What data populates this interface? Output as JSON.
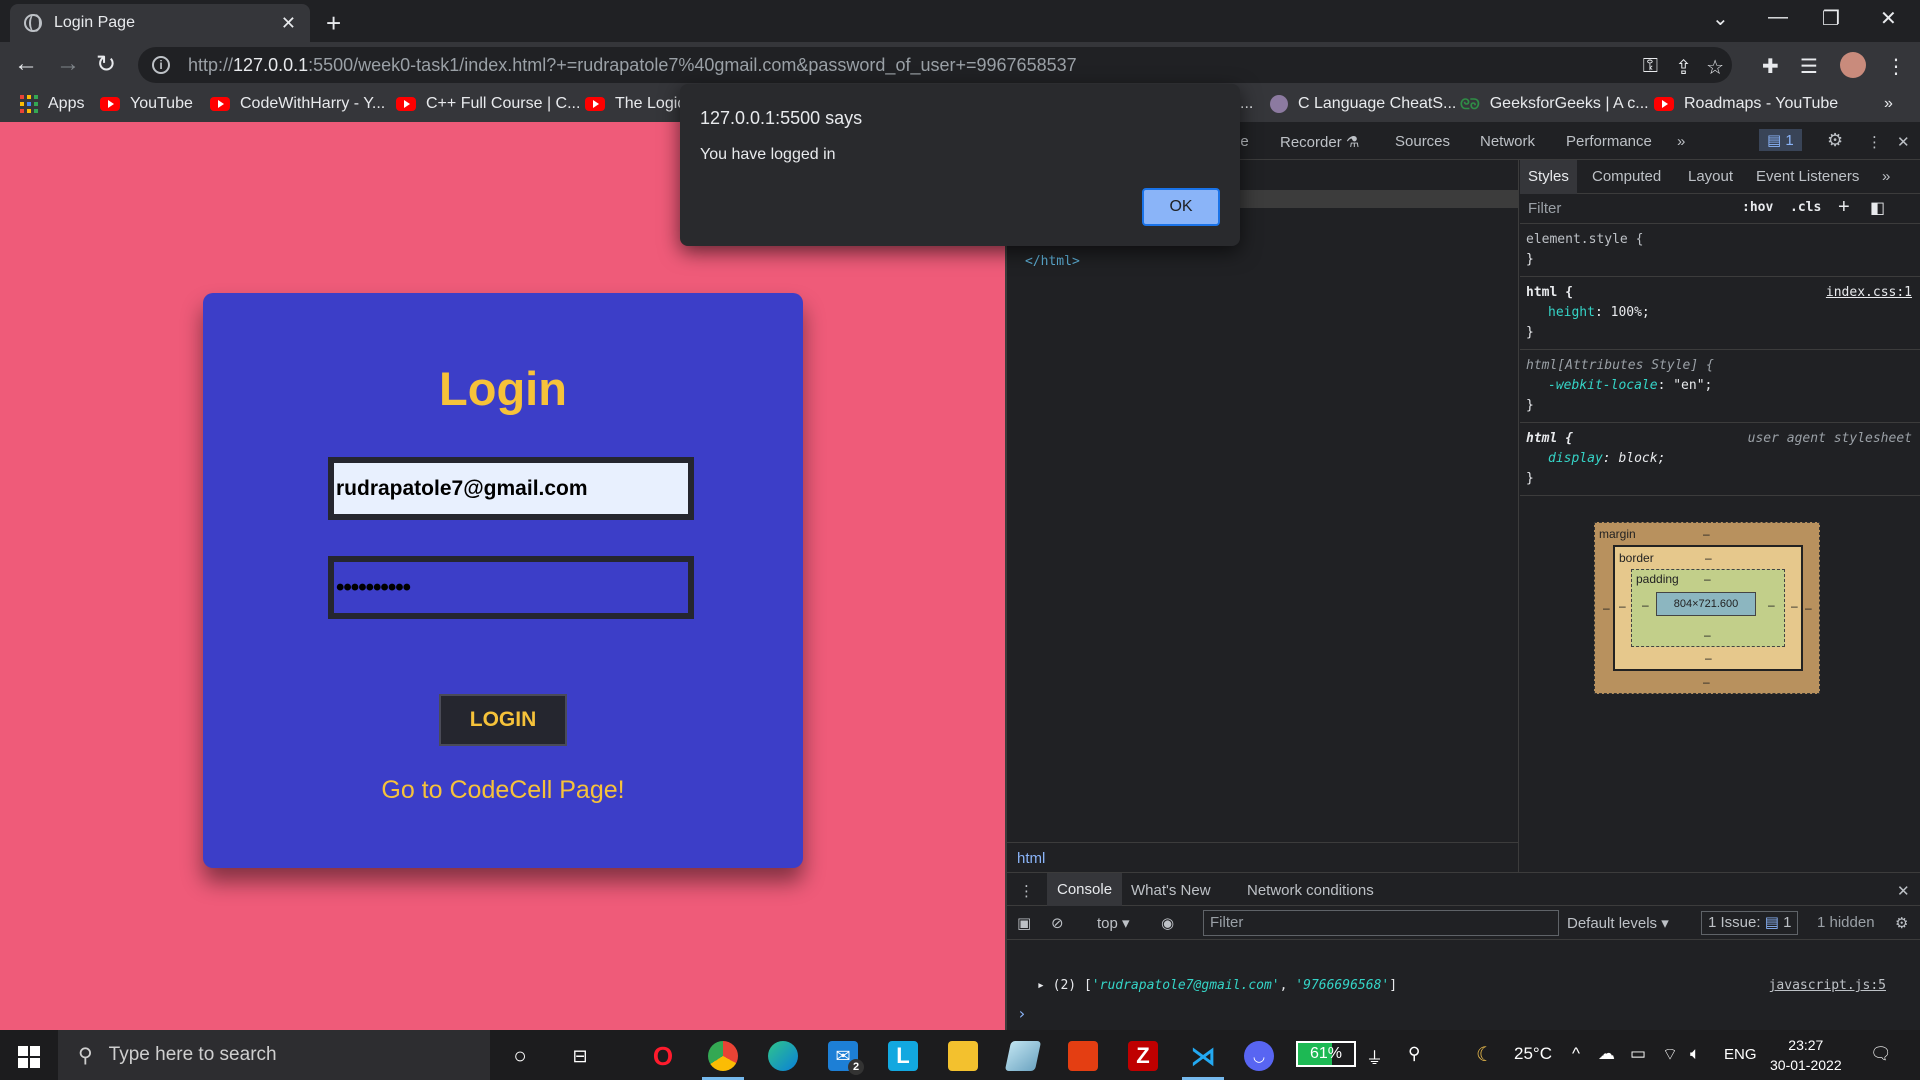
{
  "browser": {
    "tab_title": "Login Page",
    "url_host": "127.0.0.1",
    "url_rest": ":5500/week0-task1/index.html?+=rudrapatole7%40gmail.com&password_of_user+=9967658537",
    "url_prefix": "http://"
  },
  "bookmarks": [
    {
      "label": "Apps"
    },
    {
      "label": "YouTube"
    },
    {
      "label": "CodeWithHarry - Y..."
    },
    {
      "label": "C++ Full Course | C..."
    },
    {
      "label": "The Logic"
    },
    {
      "label": "C Language CheatS..."
    },
    {
      "label": "GeeksforGeeks | A c..."
    },
    {
      "label": "Roadmaps - YouTube"
    }
  ],
  "alert": {
    "origin": "127.0.0.1:5500 says",
    "message": "You have logged in",
    "ok_label": "OK"
  },
  "login_page": {
    "heading": "Login",
    "email_value": "rudrapatole7@gmail.com",
    "password_mask": "••••••••••",
    "button_label": "LOGIN",
    "link_text": "Go to CodeCell Page!"
  },
  "devtools": {
    "tabs": [
      "le",
      "Recorder",
      "Sources",
      "Network",
      "Performance",
      "»"
    ],
    "issues_badge": "1",
    "elements_code": "</html>",
    "breadcrumb": "html",
    "styles_tabs": [
      "Styles",
      "Computed",
      "Layout",
      "Event Listeners",
      "»"
    ],
    "filter_placeholder": "Filter",
    "hov": ":hov",
    "cls": ".cls",
    "rules": {
      "r1_selector": "element.style {",
      "r2_selector": "html {",
      "r2_source": "index.css:1",
      "r2_prop": "height",
      "r2_val": "100%;",
      "r3_selector": "html[Attributes Style] {",
      "r3_prop": "-webkit-locale",
      "r3_val": "\"en\";",
      "r4_selector": "html {",
      "r4_source": "user agent stylesheet",
      "r4_prop": "display",
      "r4_val": "block;",
      "close": "}"
    },
    "boxmodel": {
      "margin": "margin",
      "border": "border",
      "padding": "padding",
      "content": "804×721.600",
      "dash": "–"
    },
    "console_tabs": [
      "Console",
      "What's New",
      "Network conditions"
    ],
    "console_context": "top ▾",
    "console_filter": "Filter",
    "levels": "Default levels ▾",
    "issues": "1 Issue:",
    "issues_count": "1",
    "hidden": "1 hidden",
    "log_prefix": "▸ (2) [",
    "log_s1": "'rudrapatole7@gmail.com'",
    "log_sep": ", ",
    "log_s2": "'9766696568'",
    "log_suffix": "]",
    "log_source": "javascript.js:5",
    "prompt": "›"
  },
  "taskbar": {
    "search_placeholder": "Type here to search",
    "battery": "61%",
    "weather": "25°C",
    "lang": "ENG",
    "time": "23:27",
    "date": "30-01-2022",
    "mail_badge": "2"
  },
  "colors": {
    "page_bg": "#ef5b79",
    "card_bg": "#3c3ec8",
    "accent_yellow": "#f6c23a"
  }
}
